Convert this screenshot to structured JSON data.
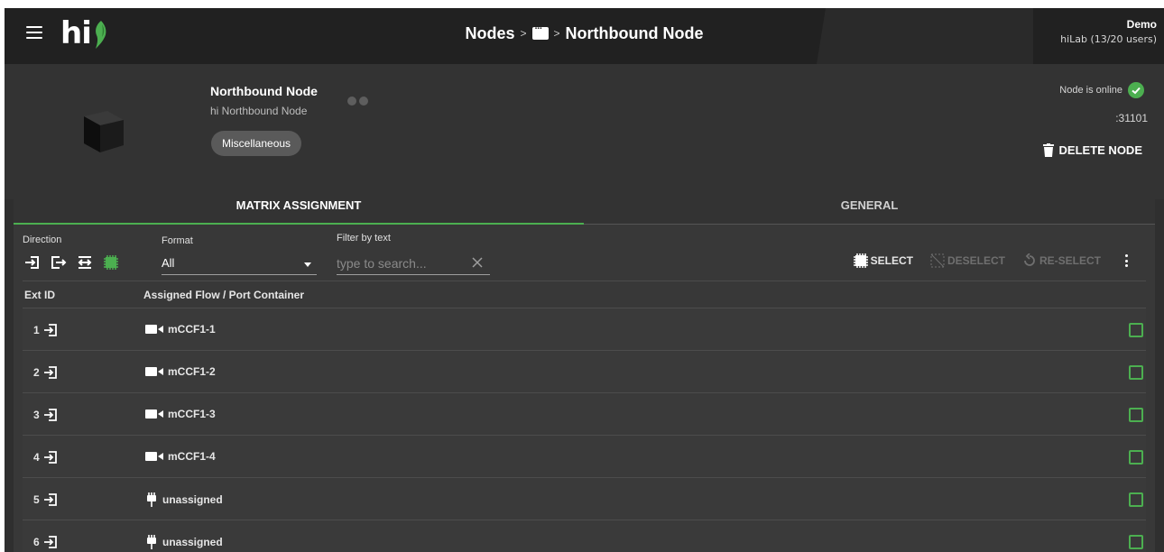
{
  "topbar": {
    "logo_text": "hi",
    "breadcrumb": {
      "root": "Nodes",
      "separator": ">",
      "current": "Northbound Node"
    },
    "user": {
      "name": "Demo",
      "org": "hiLab (13/20 users)"
    }
  },
  "node": {
    "title": "Northbound Node",
    "subtitle": "hi Northbound Node",
    "category": "Miscellaneous",
    "status_text": "Node is online",
    "port": ":31101",
    "delete_label": "DELETE NODE"
  },
  "tabs": [
    {
      "label": "MATRIX ASSIGNMENT",
      "active": true
    },
    {
      "label": "GENERAL",
      "active": false
    }
  ],
  "filters": {
    "direction_label": "Direction",
    "direction_icons": [
      "input-icon",
      "output-icon",
      "bidirectional-icon",
      "chip-icon"
    ],
    "format_label": "Format",
    "format_value": "All",
    "filter_label": "Filter by text",
    "filter_placeholder": "type to search..."
  },
  "actions": {
    "select": "SELECT",
    "deselect": "DESELECT",
    "reselect": "RE-SELECT"
  },
  "table": {
    "columns": [
      "Ext ID",
      "Assigned Flow / Port Container"
    ],
    "rows": [
      {
        "id": "1",
        "flow": "mCCF1-1",
        "icon": "video-camera-icon"
      },
      {
        "id": "2",
        "flow": "mCCF1-2",
        "icon": "video-camera-icon"
      },
      {
        "id": "3",
        "flow": "mCCF1-3",
        "icon": "video-camera-icon"
      },
      {
        "id": "4",
        "flow": "mCCF1-4",
        "icon": "video-camera-icon"
      },
      {
        "id": "5",
        "flow": "unassigned",
        "icon": "plug-icon"
      },
      {
        "id": "6",
        "flow": "unassigned",
        "icon": "plug-icon"
      }
    ]
  },
  "colors": {
    "accent": "#4caf50",
    "topbar": "#212121",
    "panel": "#333333"
  }
}
